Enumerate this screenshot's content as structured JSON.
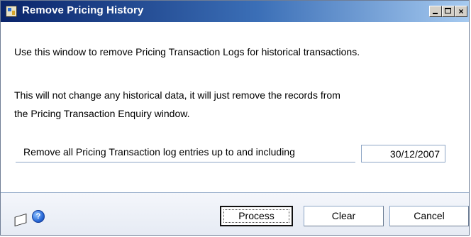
{
  "window": {
    "title": "Remove Pricing History",
    "controls": {
      "minimize": "minimize",
      "maximize": "maximize",
      "close": "×"
    }
  },
  "content": {
    "intro": "Use this window to remove Pricing Transaction Logs for historical transactions.",
    "note_line1": "This will not change any historical data, it will just remove the records from",
    "note_line2": "the Pricing Transaction Enquiry window.",
    "date_label": "Remove all Pricing Transaction log entries up to and including",
    "date_value": "30/12/2007"
  },
  "footer": {
    "icons": [
      "note-icon",
      "help-icon"
    ],
    "help_glyph": "?",
    "buttons": {
      "process": "Process",
      "clear": "Clear",
      "cancel": "Cancel"
    }
  },
  "colors": {
    "title_gradient_start": "#0a246a",
    "title_gradient_end": "#a6caf0",
    "footer_background": "#e6ebf4",
    "border_accent": "#8ea6c6"
  }
}
